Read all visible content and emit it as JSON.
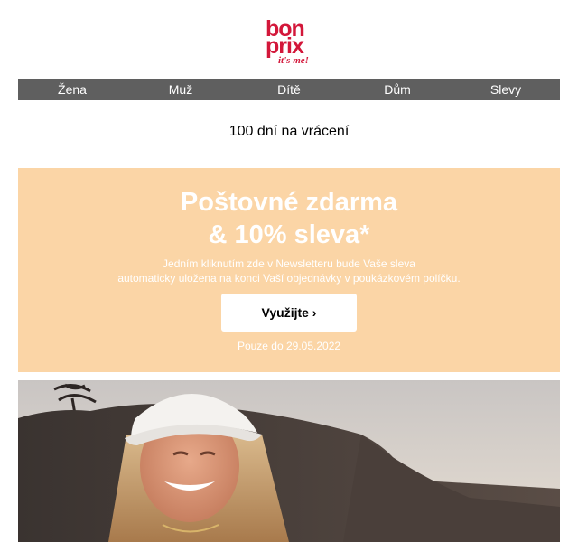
{
  "brand": {
    "logo_line1": "bon",
    "logo_line2": "prix",
    "tagline": "it's me!",
    "color": "#d3173a"
  },
  "nav": {
    "items": [
      "Žena",
      "Muž",
      "Dítě",
      "Dům",
      "Slevy"
    ],
    "background": "#5f5f5f"
  },
  "returns_text": "100 dní na vrácení",
  "promo": {
    "title_line1": "Poštovné zdarma",
    "title_line2": "& 10% sleva*",
    "text_line1": "Jedním kliknutím zde v Newsletteru bude Vaše sleva",
    "text_line2": "automaticky uložena na konci Vaší objednávky v poukázkovém políčku.",
    "cta_label": "Využijte ›",
    "validity": "Pouze do 29.05.2022",
    "background": "#fbd5a6"
  },
  "hero": {
    "image_icon": "beach-photo-woman-in-white-bucket-hat"
  }
}
